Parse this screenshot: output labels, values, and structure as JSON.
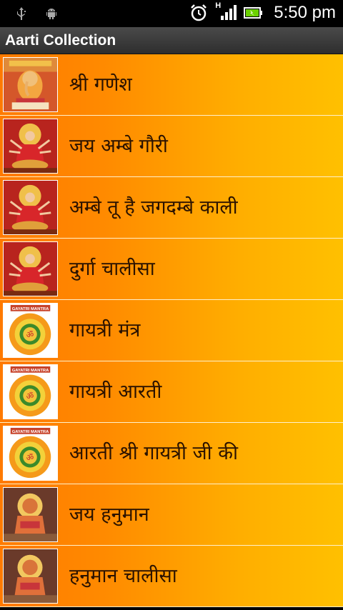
{
  "status_bar": {
    "time": "5:50 pm",
    "network_type": "H",
    "icons": [
      "usb-icon",
      "android-icon",
      "alarm-clock-icon",
      "signal-icon",
      "battery-icon"
    ]
  },
  "header": {
    "title": "Aarti Collection"
  },
  "colors": {
    "list_gradient_start": "#ff7a00",
    "list_gradient_end": "#ffc000",
    "title_bar": "#3a3a3a",
    "text": "#2a1200"
  },
  "list": {
    "items": [
      {
        "label": "श्री गणेश",
        "image": "ganesh-image"
      },
      {
        "label": "जय अम्बे गौरी",
        "image": "durga-image"
      },
      {
        "label": "अम्बे तू है जगदम्बे काली",
        "image": "durga-image"
      },
      {
        "label": "दुर्गा चालीसा",
        "image": "durga-image"
      },
      {
        "label": "गायत्री मंत्र",
        "image": "gayatri-mantra-image",
        "image_text": "GAYATRI MANTRA"
      },
      {
        "label": "गायत्री आरती",
        "image": "gayatri-mantra-image",
        "image_text": "GAYATRI MANTRA"
      },
      {
        "label": "आरती श्री गायत्री जी की",
        "image": "gayatri-mantra-image",
        "image_text": "GAYATRI MANTRA"
      },
      {
        "label": "जय हनुमान",
        "image": "hanuman-image"
      },
      {
        "label": "हनुमान चालीसा",
        "image": "hanuman-image"
      }
    ]
  }
}
